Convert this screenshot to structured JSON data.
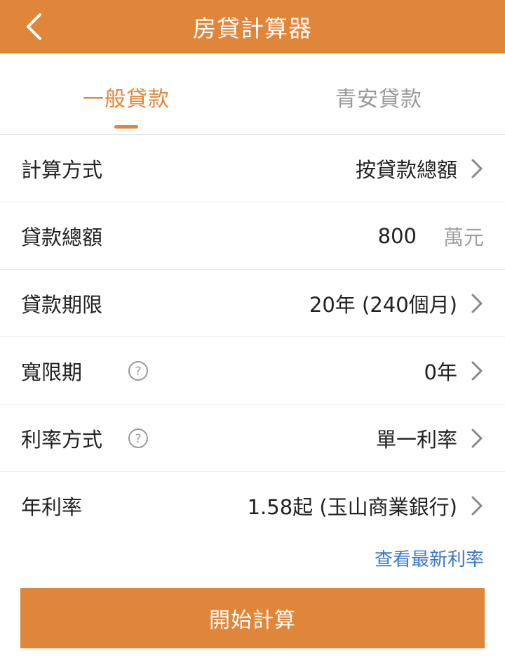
{
  "header": {
    "title": "房貸計算器",
    "back_icon": "chevron-left-icon"
  },
  "tabs": [
    {
      "label": "一般貸款",
      "active": true
    },
    {
      "label": "青安貸款",
      "active": false
    }
  ],
  "rows": [
    {
      "label": "計算方式",
      "value": "按貸款總額",
      "has_chevron": true
    },
    {
      "label": "貸款總額",
      "value": "800",
      "unit": "萬元"
    },
    {
      "label": "貸款期限",
      "value": "20年 (240個月)",
      "has_chevron": true
    },
    {
      "label": "寬限期",
      "value": "0年",
      "has_help": true,
      "has_chevron": true
    },
    {
      "label": "利率方式",
      "value": "單一利率",
      "has_help": true,
      "has_chevron": true
    },
    {
      "label": "年利率",
      "value": "1.58起 (玉山商業銀行)",
      "has_chevron": true
    }
  ],
  "latest_rate_link": "查看最新利率",
  "calculate_button": "開始計算",
  "colors": {
    "accent": "#E0863A",
    "link": "#3A78C9",
    "muted": "#999999"
  }
}
